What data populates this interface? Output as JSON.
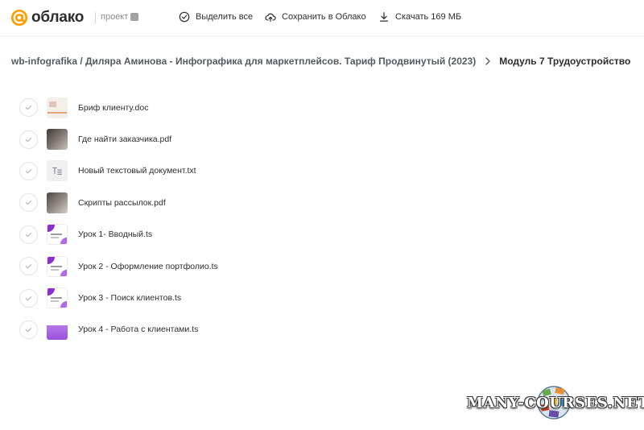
{
  "header": {
    "logo_text": "облако",
    "project_label": "проект",
    "actions": {
      "select_all": "Выделить все",
      "save_to_cloud": "Сохранить в Облако",
      "download": "Скачать 169 МБ"
    }
  },
  "breadcrumb": {
    "parent": "wb-infografika / Диляра Аминова - Инфографика для маркетплейсов. Тариф Продвинутый (2023)",
    "current": "Модуль 7 Трудоустройство"
  },
  "files": [
    {
      "name": "Бриф клиенту.doc",
      "thumb": "doc"
    },
    {
      "name": "Где найти заказчика.pdf",
      "thumb": "photo"
    },
    {
      "name": "Новый текстовый документ.txt",
      "thumb": "txt"
    },
    {
      "name": "Скрипты рассылок.pdf",
      "thumb": "photo"
    },
    {
      "name": "Урок 1- Вводный.ts",
      "thumb": "slide"
    },
    {
      "name": "Урок 2 - Оформление портфолио.ts",
      "thumb": "slide"
    },
    {
      "name": "Урок 3 - Поиск клиентов.ts",
      "thumb": "slide"
    },
    {
      "name": "Урок 4 - Работа с клиентами.ts",
      "thumb": "purple"
    }
  ],
  "watermark": {
    "text": "MANY-COURSES.NET"
  },
  "colors": {
    "logo_orange": "#ff9e00",
    "accent_purple": "#8a2fd1",
    "text": "#2c2d2e"
  }
}
